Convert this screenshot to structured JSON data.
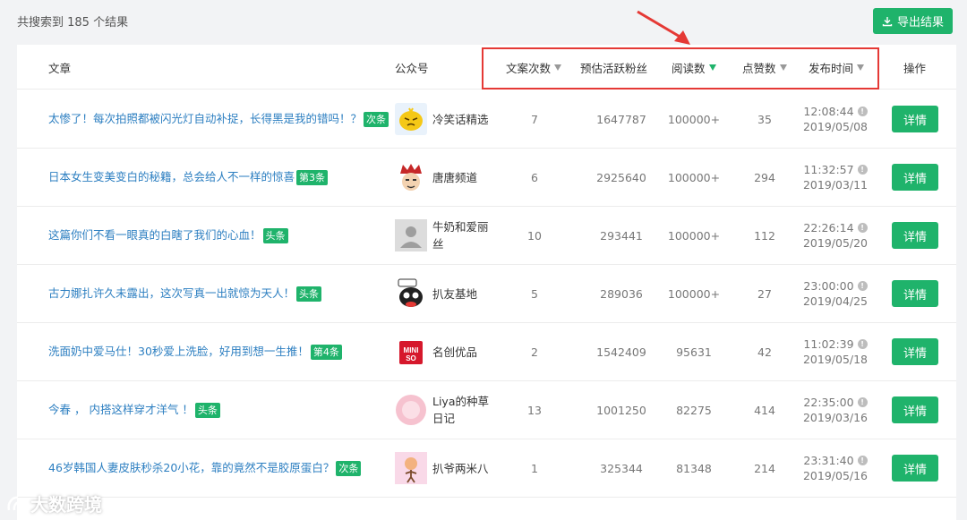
{
  "header": {
    "result_count": "共搜索到 185 个结果",
    "export_label": "导出结果"
  },
  "columns": {
    "article": "文章",
    "account": "公众号",
    "copy_count": "文案次数",
    "active_fans": "预估活跃粉丝",
    "reads": "阅读数",
    "likes": "点赞数",
    "publish_time": "发布时间",
    "actions": "操作"
  },
  "rows": [
    {
      "title": "太惨了！每次拍照都被闪光灯自动补捉，长得黑是我的错吗！？",
      "tag": "次条",
      "account": "冷笑话精选",
      "avatar": "yellow-chick-avatar",
      "copy_count": "7",
      "fans": "1647787",
      "reads": "100000+",
      "likes": "35",
      "time": "12:08:44",
      "date": "2019/05/08",
      "action": "详情"
    },
    {
      "title": "日本女生变美变白的秘籍，总会给人不一样的惊喜",
      "tag": "第3条",
      "account": "唐唐频道",
      "avatar": "cartoon-king-avatar",
      "copy_count": "6",
      "fans": "2925640",
      "reads": "100000+",
      "likes": "294",
      "time": "11:32:57",
      "date": "2019/03/11",
      "action": "详情"
    },
    {
      "title": "这篇你们不看一眼真的白瞎了我们的心血！",
      "tag": "头条",
      "account": "牛奶和爱丽丝",
      "avatar": "default-user-avatar",
      "copy_count": "10",
      "fans": "293441",
      "reads": "100000+",
      "likes": "112",
      "time": "22:26:14",
      "date": "2019/05/20",
      "action": "详情"
    },
    {
      "title": "古力娜扎许久未露出，这次写真一出就惊为天人！",
      "tag": "头条",
      "account": "扒友基地",
      "avatar": "black-cartoon-avatar",
      "copy_count": "5",
      "fans": "289036",
      "reads": "100000+",
      "likes": "27",
      "time": "23:00:00",
      "date": "2019/04/25",
      "action": "详情"
    },
    {
      "title": "洗面奶中爱马仕！30秒爱上洗脸，好用到想一生推！",
      "tag": "第4条",
      "account": "名创优品",
      "avatar": "miniso-logo-avatar",
      "copy_count": "2",
      "fans": "1542409",
      "reads": "95631",
      "likes": "42",
      "time": "11:02:39",
      "date": "2019/05/18",
      "action": "详情"
    },
    {
      "title": "今春 ， 内搭这样穿才洋气 ！",
      "tag": "头条",
      "account": "Liya的种草日记",
      "avatar": "pink-circle-avatar",
      "copy_count": "13",
      "fans": "1001250",
      "reads": "82275",
      "likes": "414",
      "time": "22:35:00",
      "date": "2019/03/16",
      "action": "详情"
    },
    {
      "title": "46岁韩国人妻皮肤秒杀20小花，靠的竟然不是胶原蛋白？",
      "tag": "次条",
      "account": "扒爷两米八",
      "avatar": "pink-cartoon-avatar",
      "copy_count": "1",
      "fans": "325344",
      "reads": "81348",
      "likes": "214",
      "time": "23:31:40",
      "date": "2019/05/16",
      "action": "详情"
    }
  ],
  "watermark": "大数跨境",
  "colors": {
    "accent": "#1fb36b",
    "link": "#2d7fc1",
    "highlight": "#e53935"
  }
}
